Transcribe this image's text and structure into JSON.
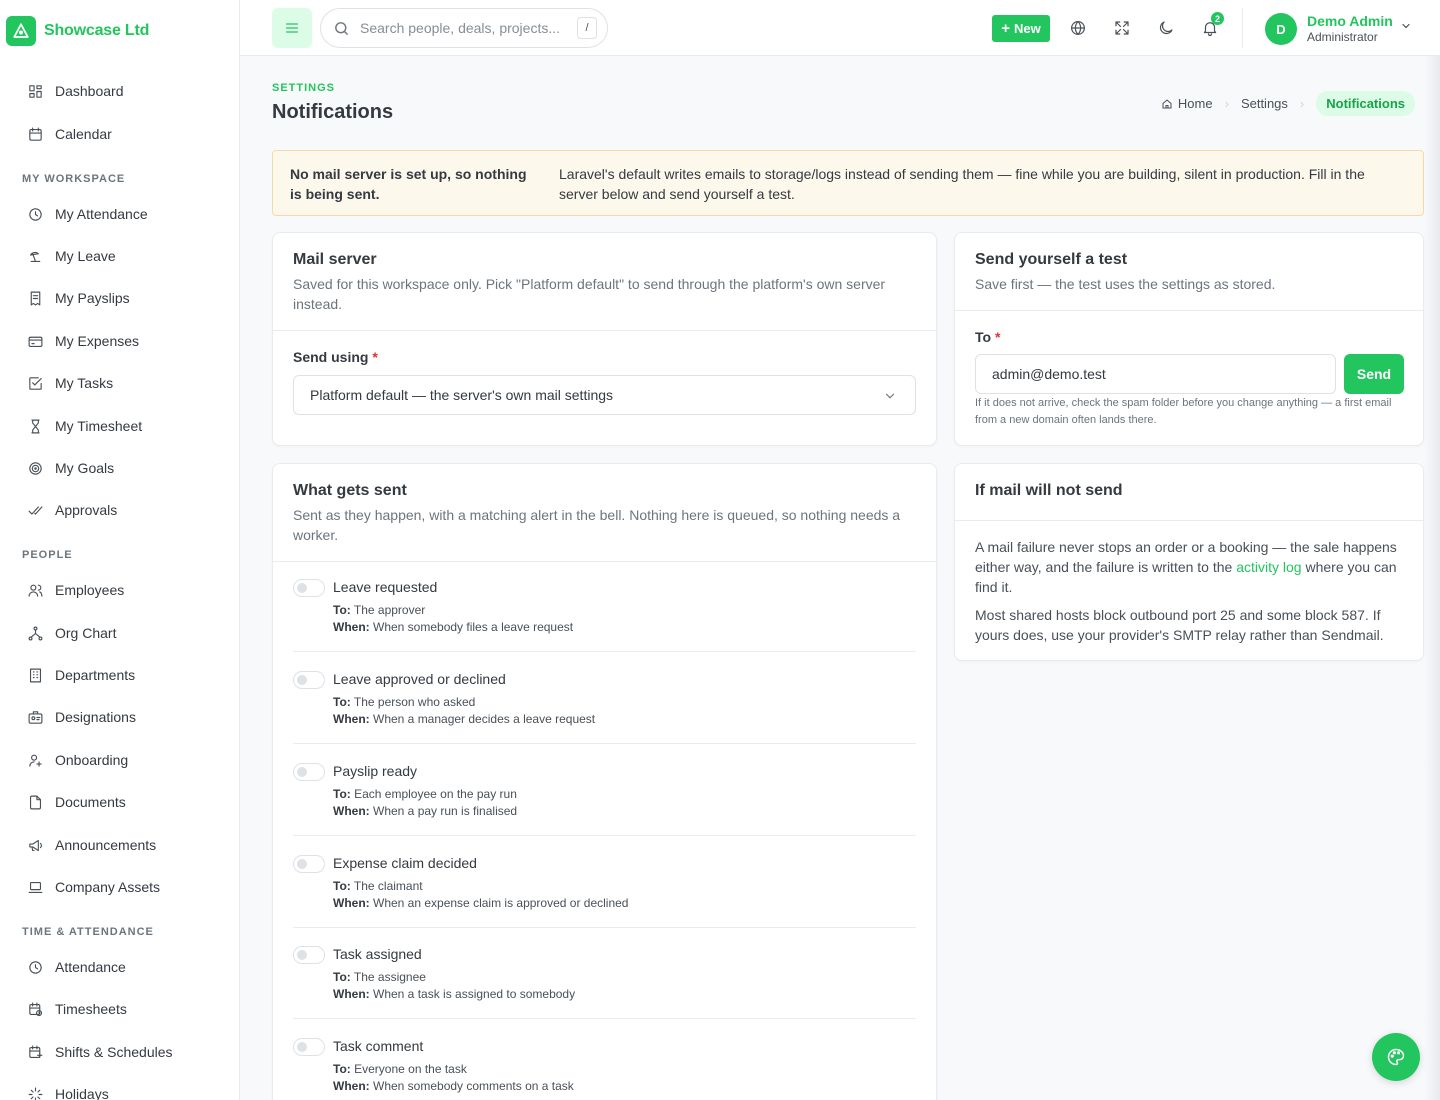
{
  "brand": {
    "name": "Showcase Ltd"
  },
  "sidebar": {
    "top_items": [
      {
        "label": "Dashboard",
        "icon": "dashboard-icon"
      },
      {
        "label": "Calendar",
        "icon": "calendar-icon"
      }
    ],
    "sections": [
      {
        "title": "MY WORKSPACE",
        "items": [
          {
            "label": "My Attendance",
            "icon": "clock-icon"
          },
          {
            "label": "My Leave",
            "icon": "beach-icon"
          },
          {
            "label": "My Payslips",
            "icon": "receipt-icon"
          },
          {
            "label": "My Expenses",
            "icon": "card-icon"
          },
          {
            "label": "My Tasks",
            "icon": "check-square-icon"
          },
          {
            "label": "My Timesheet",
            "icon": "hourglass-icon"
          },
          {
            "label": "My Goals",
            "icon": "target-icon"
          },
          {
            "label": "Approvals",
            "icon": "double-check-icon"
          }
        ]
      },
      {
        "title": "PEOPLE",
        "items": [
          {
            "label": "Employees",
            "icon": "users-icon"
          },
          {
            "label": "Org Chart",
            "icon": "hierarchy-icon"
          },
          {
            "label": "Departments",
            "icon": "building-icon"
          },
          {
            "label": "Designations",
            "icon": "id-badge-icon"
          },
          {
            "label": "Onboarding",
            "icon": "user-plus-icon"
          },
          {
            "label": "Documents",
            "icon": "document-icon"
          },
          {
            "label": "Announcements",
            "icon": "megaphone-icon"
          },
          {
            "label": "Company Assets",
            "icon": "laptop-icon"
          }
        ]
      },
      {
        "title": "TIME & ATTENDANCE",
        "items": [
          {
            "label": "Attendance",
            "icon": "clock-icon"
          },
          {
            "label": "Timesheets",
            "icon": "calendar-clock-icon"
          },
          {
            "label": "Shifts & Schedules",
            "icon": "calendar-shift-icon"
          },
          {
            "label": "Holidays",
            "icon": "sparkle-icon"
          }
        ]
      }
    ]
  },
  "topbar": {
    "search_placeholder": "Search people, deals, projects...",
    "search_shortcut": "/",
    "new_label": "New",
    "notification_count": "2",
    "user_name": "Demo Admin",
    "user_role": "Administrator",
    "avatar_initial": "D"
  },
  "header": {
    "eyebrow": "SETTINGS",
    "title": "Notifications",
    "breadcrumb": [
      "Home",
      "Settings",
      "Notifications"
    ]
  },
  "alert": {
    "title": "No mail server is set up, so nothing is being sent.",
    "body": "Laravel's default writes emails to storage/logs instead of sending them — fine while you are building, silent in production. Fill in the server below and send yourself a test."
  },
  "mail_server": {
    "title": "Mail server",
    "subtitle": "Saved for this workspace only. Pick \"Platform default\" to send through the platform's own server instead.",
    "send_using_label": "Send using",
    "required_mark": "*",
    "selected": "Platform default — the server's own mail settings"
  },
  "test": {
    "title": "Send yourself a test",
    "subtitle": "Save first — the test uses the settings as stored.",
    "to_label": "To",
    "required_mark": "*",
    "to_value": "admin@demo.test",
    "send_label": "Send",
    "help": "If it does not arrive, check the spam folder before you change anything — a first email from a new domain often lands there."
  },
  "troubleshoot": {
    "title": "If mail will not send",
    "p1_before": "A mail failure never stops an order or a booking — the sale happens either way, and the failure is written to the ",
    "p1_link": "activity log",
    "p1_after": " where you can find it.",
    "p2": "Most shared hosts block outbound port 25 and some block 587. If yours does, use your provider's SMTP relay rather than Sendmail."
  },
  "what_gets_sent": {
    "title": "What gets sent",
    "subtitle": "Sent as they happen, with a matching alert in the bell. Nothing here is queued, so nothing needs a worker.",
    "to_prefix": "To:",
    "when_prefix": "When:",
    "items": [
      {
        "title": "Leave requested",
        "to": "The approver",
        "when": "When somebody files a leave request",
        "enabled": false
      },
      {
        "title": "Leave approved or declined",
        "to": "The person who asked",
        "when": "When a manager decides a leave request",
        "enabled": false
      },
      {
        "title": "Payslip ready",
        "to": "Each employee on the pay run",
        "when": "When a pay run is finalised",
        "enabled": false
      },
      {
        "title": "Expense claim decided",
        "to": "The claimant",
        "when": "When an expense claim is approved or declined",
        "enabled": false
      },
      {
        "title": "Task assigned",
        "to": "The assignee",
        "when": "When a task is assigned to somebody",
        "enabled": false
      },
      {
        "title": "Task comment",
        "to": "Everyone on the task",
        "when": "When somebody comments on a task",
        "enabled": false
      }
    ]
  },
  "colors": {
    "accent": "#22c55e",
    "accent_soft": "#dcfce7",
    "warning_bg": "#fdf8ec",
    "warning_border": "#f5d9a8"
  }
}
